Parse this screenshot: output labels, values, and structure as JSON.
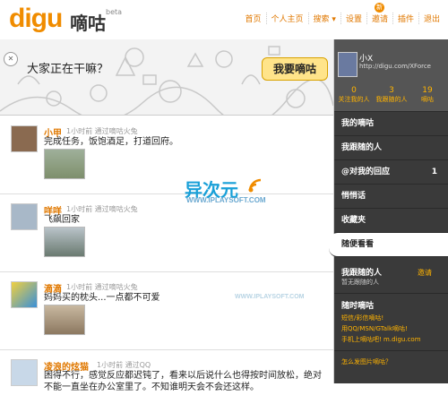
{
  "header": {
    "logo": "digu",
    "logo_cn": "嘀咕",
    "beta": "beta",
    "nav": [
      "首页",
      "个人主页",
      "搜索 ▾",
      "设置",
      "邀请",
      "插件",
      "退出"
    ],
    "new_badge": "新"
  },
  "banner": {
    "title": "大家正在干嘛？",
    "post_button": "我要嘀咕"
  },
  "feed": [
    {
      "name": "小甲",
      "meta": "1小时前 通过嘀咕火兔",
      "text": "完成任务，饭饱酒足，打道回府。",
      "avatar_color": "#8a6a50",
      "pic_color": "#7e8f6c"
    },
    {
      "name": "咩咩",
      "meta": "1小时前 通过嘀咕火兔",
      "text": "飞飙回家",
      "avatar_color": "#a8b8c8",
      "pic_color": "#6a7a70"
    },
    {
      "name": "滴滴",
      "meta": "1小时前 通过嘀咕火兔",
      "text": "妈妈买的枕头...一点都不可爱",
      "avatar_color": "#d8a040",
      "pic_color": "#8c7860"
    },
    {
      "name": "凌浪的炫猫",
      "meta": "1小时前 通过QQ",
      "text": "困得不行，感觉反应都迟钝了，看来以后说什么也得按时间放松，绝对不能一直坐在办公室里了。不知谁明天会不会还这样。",
      "avatar_color": "#c8d8e8",
      "pic_color": ""
    }
  ],
  "sidebar": {
    "name": "小X",
    "url": "http://digu.com/XForce",
    "stats": [
      {
        "n": "0",
        "l": "关注我的人"
      },
      {
        "n": "3",
        "l": "我跟随的人"
      },
      {
        "n": "19",
        "l": "嘀咕"
      }
    ],
    "menu": [
      {
        "label": "我的嘀咕",
        "count": ""
      },
      {
        "label": "我跟随的人",
        "count": ""
      },
      {
        "label": "@对我的回应",
        "count": "1"
      },
      {
        "label": "悄悄话",
        "count": ""
      },
      {
        "label": "收藏夹",
        "count": ""
      },
      {
        "label": "随便看看",
        "count": ""
      }
    ],
    "follow_title": "我跟随的人",
    "follow_invite": "邀请",
    "follow_empty": "暂无跟随的人",
    "anytime_title": "随时嘀咕",
    "links": [
      "短信/彩信嘀咕!",
      "用QQ/MSN/GTalk嘀咕!",
      "手机上嘀咕吧! m.digu.com"
    ],
    "help": "怎么发图片嘀咕？"
  },
  "watermarks": {
    "cn": "异次元",
    "url": "WWW.IPLAYSOFT.COM",
    "url2": "WWW.IPLAYSOFT.COM"
  }
}
